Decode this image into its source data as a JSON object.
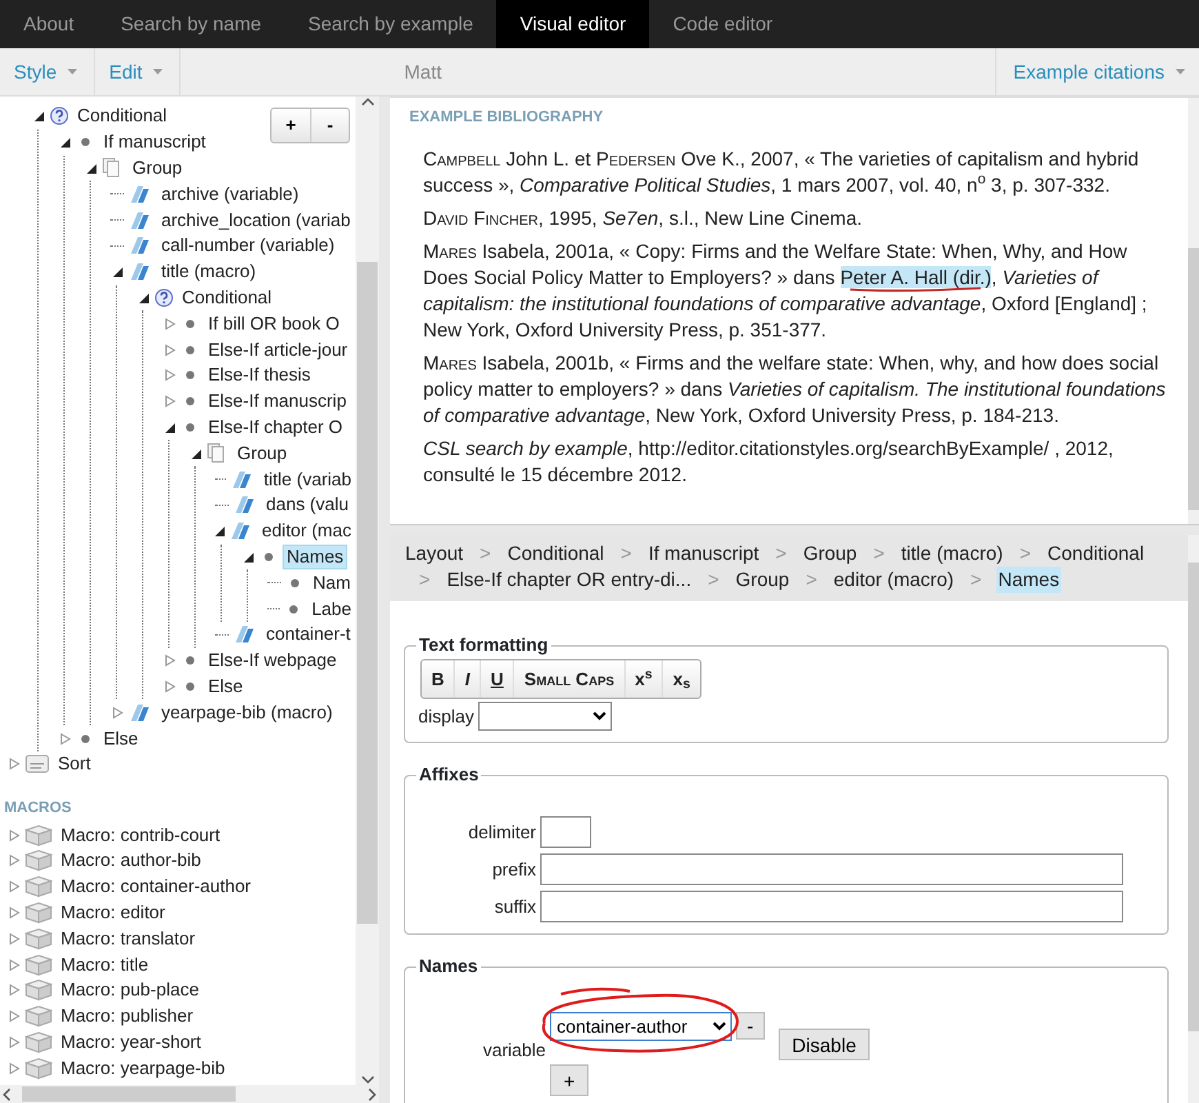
{
  "nav": [
    {
      "label": "About",
      "selected": false
    },
    {
      "label": "Search by name",
      "selected": false
    },
    {
      "label": "Search by example",
      "selected": false
    },
    {
      "label": "Visual editor",
      "selected": true
    },
    {
      "label": "Code editor",
      "selected": false
    }
  ],
  "toolbar": {
    "menus": [
      {
        "label": "Style"
      },
      {
        "label": "Edit"
      }
    ],
    "style_title": "Matt",
    "right_menu": {
      "label": "Example citations"
    }
  },
  "tree_buttons": [
    "+",
    "-"
  ],
  "tree": [
    {
      "label": "Conditional",
      "kind": "conditional",
      "expanded": true,
      "selected": false,
      "children": [
        {
          "label": "If manuscript",
          "kind": "bullet",
          "expanded": true,
          "selected": false,
          "children": [
            {
              "label": "Group",
              "kind": "group",
              "expanded": true,
              "selected": false,
              "children": [
                {
                  "label": "archive (variable)",
                  "kind": "text",
                  "leaf": true,
                  "selected": false
                },
                {
                  "label": "archive_location (variab",
                  "kind": "text",
                  "leaf": true,
                  "selected": false
                },
                {
                  "label": "call-number (variable)",
                  "kind": "text",
                  "leaf": true,
                  "selected": false
                },
                {
                  "label": "title (macro)",
                  "kind": "text",
                  "expanded": true,
                  "selected": false,
                  "children": [
                    {
                      "label": "Conditional",
                      "kind": "conditional",
                      "expanded": true,
                      "selected": false,
                      "children": [
                        {
                          "label": "If bill OR book O",
                          "kind": "bullet",
                          "expanded": false,
                          "selected": false
                        },
                        {
                          "label": "Else-If article-jour",
                          "kind": "bullet",
                          "expanded": false,
                          "selected": false
                        },
                        {
                          "label": "Else-If thesis",
                          "kind": "bullet",
                          "expanded": false,
                          "selected": false
                        },
                        {
                          "label": "Else-If manuscrip",
                          "kind": "bullet",
                          "expanded": false,
                          "selected": false
                        },
                        {
                          "label": "Else-If chapter O",
                          "kind": "bullet",
                          "expanded": true,
                          "selected": false,
                          "children": [
                            {
                              "label": "Group",
                              "kind": "group",
                              "expanded": true,
                              "selected": false,
                              "children": [
                                {
                                  "label": "title (variab",
                                  "kind": "text",
                                  "leaf": true,
                                  "selected": false
                                },
                                {
                                  "label": "dans (valu",
                                  "kind": "text",
                                  "leaf": true,
                                  "selected": false
                                },
                                {
                                  "label": "editor (mac",
                                  "kind": "text",
                                  "expanded": true,
                                  "selected": false,
                                  "children": [
                                    {
                                      "label": "Names",
                                      "kind": "bullet",
                                      "expanded": true,
                                      "selected": true,
                                      "children": [
                                        {
                                          "label": "Nam",
                                          "kind": "bullet",
                                          "leaf": true,
                                          "selected": false
                                        },
                                        {
                                          "label": "Labe",
                                          "kind": "bullet",
                                          "leaf": true,
                                          "selected": false
                                        }
                                      ]
                                    }
                                  ]
                                },
                                {
                                  "label": "container-t",
                                  "kind": "text",
                                  "leaf": true,
                                  "selected": false
                                }
                              ]
                            }
                          ]
                        },
                        {
                          "label": "Else-If webpage",
                          "kind": "bullet",
                          "expanded": false,
                          "selected": false
                        },
                        {
                          "label": "Else",
                          "kind": "bullet",
                          "expanded": false,
                          "selected": false
                        }
                      ]
                    }
                  ]
                },
                {
                  "label": "yearpage-bib (macro)",
                  "kind": "text",
                  "expanded": false,
                  "selected": false
                }
              ]
            }
          ]
        },
        {
          "label": "Else",
          "kind": "bullet",
          "expanded": false,
          "selected": false
        }
      ]
    }
  ],
  "sort_node": {
    "label": "Sort",
    "kind": "sort",
    "expanded": false,
    "selected": false
  },
  "macros_heading": "MACROS",
  "macros": [
    {
      "label": "Macro: contrib-court",
      "expanded": false
    },
    {
      "label": "Macro: author-bib",
      "expanded": false
    },
    {
      "label": "Macro: container-author",
      "expanded": false
    },
    {
      "label": "Macro: editor",
      "expanded": false
    },
    {
      "label": "Macro: translator",
      "expanded": false
    },
    {
      "label": "Macro: title",
      "expanded": false
    },
    {
      "label": "Macro: pub-place",
      "expanded": false
    },
    {
      "label": "Macro: publisher",
      "expanded": false
    },
    {
      "label": "Macro: year-short",
      "expanded": false
    },
    {
      "label": "Macro: yearpage-bib",
      "expanded": false
    }
  ],
  "bibliography": {
    "heading": "EXAMPLE BIBLIOGRAPHY",
    "entries": [
      [
        {
          "text": "Campbell",
          "kind": "smallcaps"
        },
        {
          "text": " John L. et ",
          "kind": "plain"
        },
        {
          "text": "Pedersen",
          "kind": "smallcaps"
        },
        {
          "text": " Ove K., 2007, « The varieties of capitalism and hybrid success », ",
          "kind": "plain"
        },
        {
          "text": "Comparative Political Studies",
          "kind": "italic"
        },
        {
          "text": ", 1 mars 2007, vol. 40, n",
          "kind": "plain"
        },
        {
          "text": "o",
          "kind": "superscript"
        },
        {
          "text": " 3, p. 307-332.",
          "kind": "plain"
        }
      ],
      [
        {
          "text": "David Fincher",
          "kind": "smallcaps"
        },
        {
          "text": ", 1995, ",
          "kind": "plain"
        },
        {
          "text": "Se7en",
          "kind": "italic"
        },
        {
          "text": ", s.l., New Line Cinema.",
          "kind": "plain"
        }
      ],
      [
        {
          "text": "Mares",
          "kind": "smallcaps"
        },
        {
          "text": " Isabela, 2001a, « Copy: Firms and the Welfare State: When, Why, and How Does Social Policy Matter to Employers? » dans ",
          "kind": "plain"
        },
        {
          "text": "Peter A. Hall (dir.)",
          "kind": "highlight"
        },
        {
          "text": ", ",
          "kind": "plain"
        },
        {
          "text": "Varieties of capitalism: the institutional foundations of comparative advantage",
          "kind": "italic"
        },
        {
          "text": ", Oxford [England] ; New York, Oxford University Press, p. 351-377.",
          "kind": "plain"
        }
      ],
      [
        {
          "text": "Mares",
          "kind": "smallcaps"
        },
        {
          "text": " Isabela, 2001b, « Firms and the welfare state: When, why, and how does social policy matter to employers? » dans ",
          "kind": "plain"
        },
        {
          "text": "Varieties of capitalism. The institutional foundations of comparative advantage",
          "kind": "italic"
        },
        {
          "text": ", New York, Oxford University Press, p. 184-213.",
          "kind": "plain"
        }
      ],
      [
        {
          "text": "CSL search by example",
          "kind": "italic"
        },
        {
          "text": ", http://editor.citationstyles.org/searchByExample/ , 2012, consulté le 15 décembre 2012.",
          "kind": "plain"
        }
      ]
    ]
  },
  "editor": {
    "separator": ">",
    "breadcrumb": [
      {
        "label": "Layout",
        "selected": false
      },
      {
        "label": "Conditional",
        "selected": false
      },
      {
        "label": "If manuscript",
        "selected": false
      },
      {
        "label": "Group",
        "selected": false
      },
      {
        "label": "title (macro)",
        "selected": false
      },
      {
        "label": "Conditional",
        "selected": false
      },
      {
        "label": "Else-If chapter OR entry-di...",
        "selected": false
      },
      {
        "label": "Group",
        "selected": false
      },
      {
        "label": "editor (macro)",
        "selected": false
      },
      {
        "label": "Names",
        "selected": true
      }
    ],
    "text_formatting": {
      "title": "Text formatting",
      "buttons": [
        {
          "label": "B",
          "kind": "bold"
        },
        {
          "label": "I",
          "kind": "italic"
        },
        {
          "label": "U",
          "kind": "underline"
        },
        {
          "label": "Small Caps",
          "kind": "smallcaps"
        },
        {
          "label": "x$^{s}$",
          "kind": "superscript"
        },
        {
          "label": "x$_{s}$",
          "kind": "subscript"
        }
      ],
      "display": {
        "label": "display"
      }
    },
    "affixes": {
      "title": "Affixes",
      "fields": [
        {
          "label": "delimiter",
          "kind": "short"
        },
        {
          "label": "prefix",
          "kind": "wide"
        },
        {
          "label": "suffix",
          "kind": "wide"
        }
      ]
    },
    "names": {
      "title": "Names",
      "variable": {
        "label": "variable",
        "value": "container-author"
      },
      "remove_button": "-",
      "add_button": "+",
      "disable_button": "Disable"
    }
  }
}
